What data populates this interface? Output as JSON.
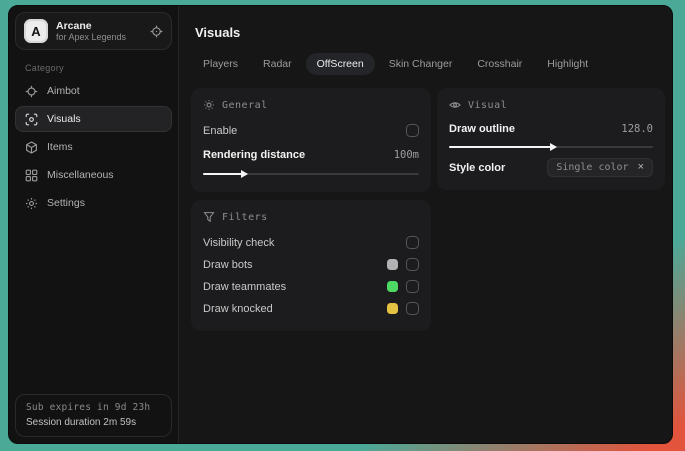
{
  "sidebar": {
    "brand": {
      "logo_letter": "A",
      "name": "Arcane",
      "subtitle": "for Apex Legends"
    },
    "category_label": "Category",
    "items": [
      {
        "label": "Aimbot"
      },
      {
        "label": "Visuals"
      },
      {
        "label": "Items"
      },
      {
        "label": "Miscellaneous"
      },
      {
        "label": "Settings"
      }
    ],
    "active_item": "Visuals",
    "footer": {
      "sub_expires": "Sub expires in 9d 23h",
      "session_duration": "Session duration 2m 59s"
    }
  },
  "main": {
    "title": "Visuals",
    "tabs": [
      {
        "label": "Players"
      },
      {
        "label": "Radar"
      },
      {
        "label": "OffScreen"
      },
      {
        "label": "Skin Changer"
      },
      {
        "label": "Crosshair"
      },
      {
        "label": "Highlight"
      }
    ],
    "active_tab": "OffScreen",
    "general": {
      "header": "General",
      "enable_label": "Enable",
      "enable_checked": false,
      "rendering_distance_label": "Rendering distance",
      "rendering_distance_value": "100m",
      "rendering_distance_percent": 18
    },
    "filters": {
      "header": "Filters",
      "rows": [
        {
          "label": "Visibility check",
          "checked": false
        },
        {
          "label": "Draw bots",
          "checked": false,
          "swatch": "#b3b3b3"
        },
        {
          "label": "Draw teammates",
          "checked": false,
          "swatch": "#4cd964"
        },
        {
          "label": "Draw knocked",
          "checked": false,
          "swatch": "#e3c341"
        }
      ]
    },
    "visual": {
      "header": "Visual",
      "draw_outline_label": "Draw outline",
      "draw_outline_value": "128.0",
      "draw_outline_percent": 50,
      "style_color_label": "Style color",
      "style_color_value": "Single color",
      "clear_label": "×"
    }
  },
  "colors": {
    "desktop_teal": "#4ba998",
    "desktop_red": "#e2543c",
    "swatch_gray": "#b3b3b3",
    "swatch_green": "#4cd964",
    "swatch_yellow": "#e3c341"
  }
}
